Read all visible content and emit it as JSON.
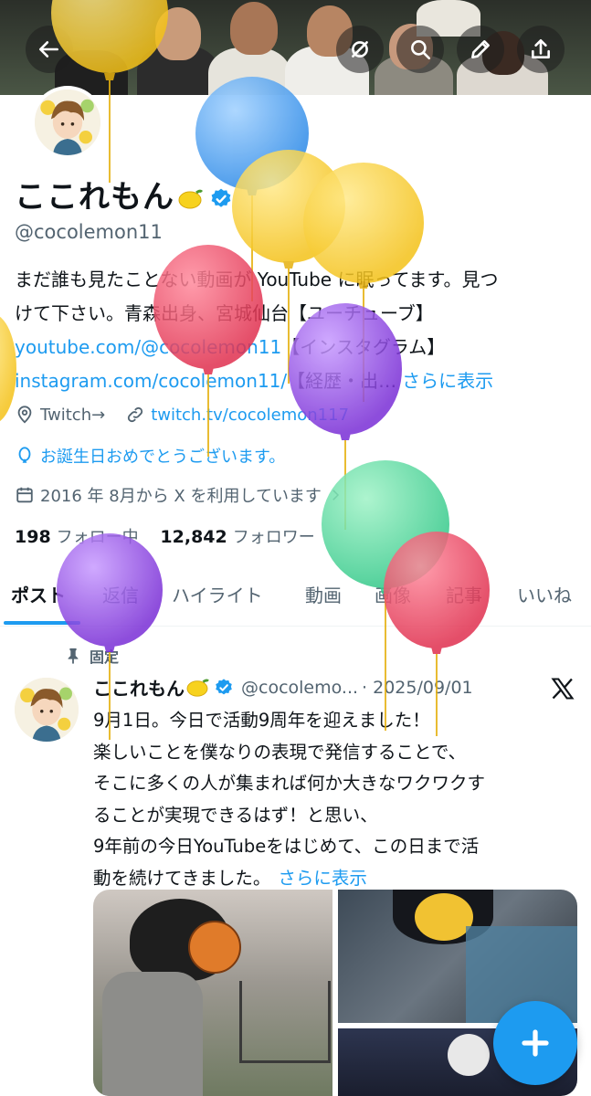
{
  "header": {
    "back_icon": "arrow-left-icon",
    "actions": [
      "no-grok-icon",
      "search-icon",
      "edit-pencil-icon",
      "share-icon"
    ]
  },
  "profile": {
    "display_name": "ここれもん",
    "handle": "@cocolemon11",
    "bio_line1": "まだ誰も見たことない動画が YouTube に眠ってます。見つ",
    "bio_line2": "けて下さい。青森出身、宮城仙台【ユーチューブ】",
    "bio_link1": "youtube.com/@cocolemon11",
    "bio_line3_rest": "【インスタグラム】",
    "bio_link2": "instagram.com/cocolemon11/",
    "bio_line4_rest": "【経歴・出…",
    "bio_more": "さらに表示",
    "location": "Twitch→",
    "website": "twitch.tv/cocolemon117",
    "birthday_text": "お誕生日おめでとうございます。",
    "joined": "2016 年 8月から X を利用しています",
    "following_count": "198",
    "following_label": "フォロー中",
    "followers_count": "12,842",
    "followers_label": "フォロワー"
  },
  "tabs": [
    "ポスト",
    "返信",
    "ハイライト",
    "動画",
    "画像",
    "記事",
    "いいね"
  ],
  "post": {
    "pinned_label": "固定",
    "author_name": "ここれもん",
    "author_handle": "@cocolemo...",
    "date": "· 2025/09/01",
    "line1": "9月1日。今日で活動9周年を迎えました！",
    "line2": "楽しいことを僕なりの表現で発信することで、",
    "line3": "そこに多くの人が集まれば何か大きなワクワクす",
    "line4": "ることが実現できるはず！と思い、",
    "line5": "9年前の今日YouTubeをはじめて、この日まで活",
    "line6": "動を続けてきました。",
    "more": "さらに表示"
  },
  "colors": {
    "accent": "#1d9bf0",
    "text": "#0f1419",
    "secondary": "#536471"
  },
  "fab_icon": "plus-icon"
}
